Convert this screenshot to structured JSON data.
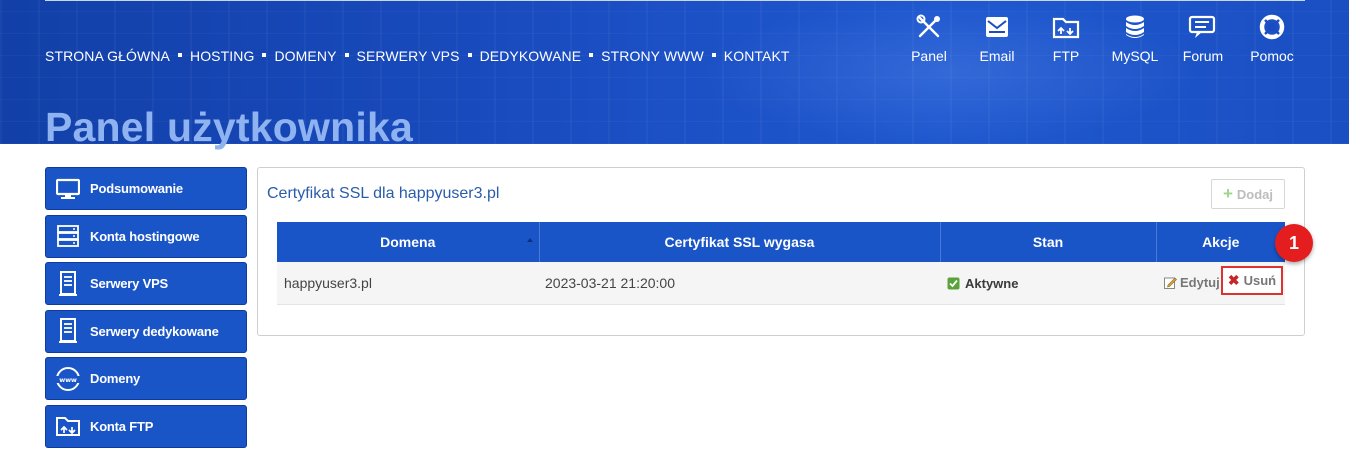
{
  "header": {
    "nav": [
      {
        "label": "STRONA GŁÓWNA"
      },
      {
        "label": "HOSTING"
      },
      {
        "label": "DOMENY"
      },
      {
        "label": "SERWERY VPS"
      },
      {
        "label": "DEDYKOWANE"
      },
      {
        "label": "STRONY WWW"
      },
      {
        "label": "KONTAKT"
      }
    ],
    "icon_links": [
      {
        "label": "Panel",
        "icon": "tools-icon"
      },
      {
        "label": "Email",
        "icon": "envelope-icon"
      },
      {
        "label": "FTP",
        "icon": "folder-icon"
      },
      {
        "label": "MySQL",
        "icon": "database-icon"
      },
      {
        "label": "Forum",
        "icon": "chat-icon"
      },
      {
        "label": "Pomoc",
        "icon": "lifebuoy-icon"
      }
    ],
    "page_title": "Panel użytkownika"
  },
  "sidebar": {
    "items": [
      {
        "label": "Podsumowanie",
        "icon": "monitor-icon"
      },
      {
        "label": "Konta hostingowe",
        "icon": "server-rack-icon"
      },
      {
        "label": "Serwery VPS",
        "icon": "server-tower-icon"
      },
      {
        "label": "Serwery dedykowane",
        "icon": "server-tower-icon"
      },
      {
        "label": "Domeny",
        "icon": "www-globe-icon"
      },
      {
        "label": "Konta FTP",
        "icon": "folder-upload-icon"
      }
    ]
  },
  "panel": {
    "title": "Certyfikat SSL dla happyuser3.pl",
    "add_label": "Dodaj",
    "columns": [
      "Domena",
      "Certyfikat SSL wygasa",
      "Stan",
      "Akcje"
    ],
    "rows": [
      {
        "domain": "happyuser3.pl",
        "expires": "2023-03-21 21:20:00",
        "status": "Aktywne",
        "edit_label": "Edytuj",
        "delete_label": "Usuń"
      }
    ]
  },
  "annotation": {
    "badge_number": "1"
  },
  "colors": {
    "header_blue": "#1a4cc0",
    "sidebar_blue": "#1a55c8",
    "title_light_blue": "#8fb2f0",
    "highlight_red": "#e03131",
    "badge_red": "#e41e1e"
  }
}
